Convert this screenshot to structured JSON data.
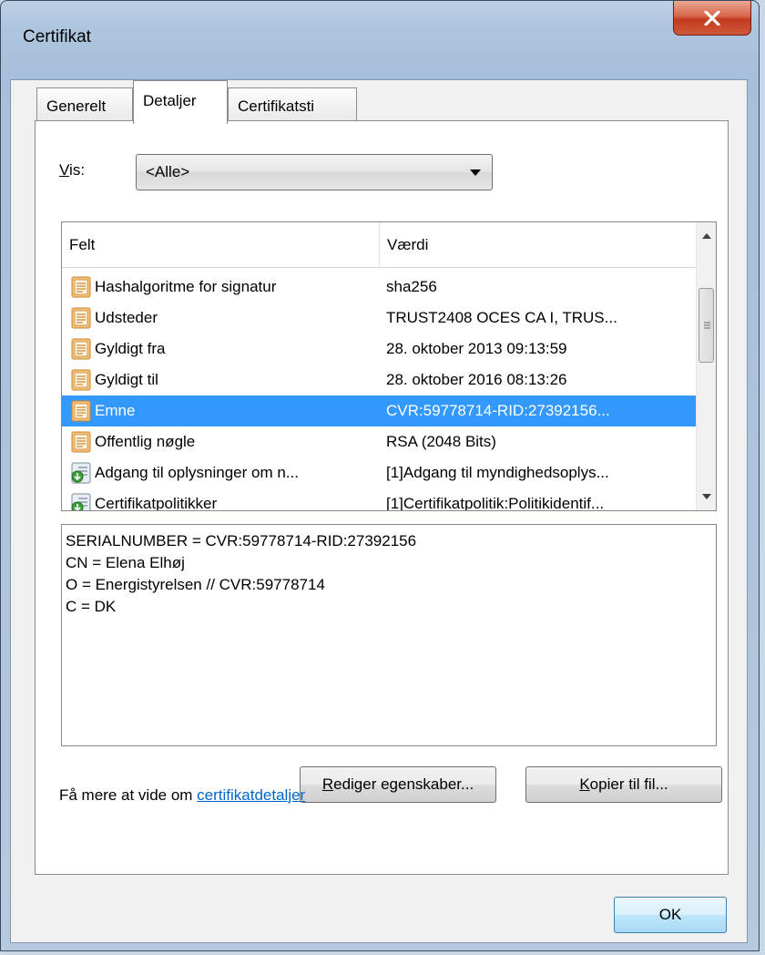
{
  "window": {
    "title": "Certifikat"
  },
  "tabs": [
    {
      "label": "Generelt",
      "active": false
    },
    {
      "label": "Detaljer",
      "active": true
    },
    {
      "label": "Certifikatsti",
      "active": false
    }
  ],
  "filter": {
    "label_accel": "V",
    "label_rest": "is:",
    "selected": "<Alle>"
  },
  "list": {
    "columns": [
      "Felt",
      "Værdi"
    ],
    "rows": [
      {
        "field": "Hashalgoritme for signatur",
        "value": "sha256",
        "icon": "certificate-field-icon"
      },
      {
        "field": "Udsteder",
        "value": "TRUST2408 OCES CA I, TRUS...",
        "icon": "certificate-field-icon"
      },
      {
        "field": "Gyldigt fra",
        "value": "28. oktober 2013 09:13:59",
        "icon": "certificate-field-icon"
      },
      {
        "field": "Gyldigt til",
        "value": "28. oktober 2016 08:13:26",
        "icon": "certificate-field-icon"
      },
      {
        "field": "Emne",
        "value": "CVR:59778714-RID:27392156...",
        "icon": "certificate-field-icon",
        "selected": true
      },
      {
        "field": "Offentlig nøgle",
        "value": "RSA (2048 Bits)",
        "icon": "certificate-field-icon"
      },
      {
        "field": "Adgang til oplysninger om n...",
        "value": "[1]Adgang til myndighedsoplys...",
        "icon": "certificate-extension-icon"
      },
      {
        "field": "Certifikatpolitikker",
        "value": "[1]Certifikatpolitik:Politikidentif...",
        "icon": "certificate-extension-icon"
      }
    ]
  },
  "details": {
    "text": "SERIALNUMBER = CVR:59778714-RID:27392156\nCN = Elena Elhøj\nO = Energistyrelsen // CVR:59778714\nC = DK"
  },
  "buttons": {
    "edit_accel": "R",
    "edit_rest": "ediger egenskaber...",
    "copy_accel": "K",
    "copy_rest": "opier til fil...",
    "ok": "OK"
  },
  "footer": {
    "text": "Få mere at vide om ",
    "link": "certifikatdetaljer"
  },
  "colors": {
    "selection": "#3399ff",
    "link": "#0066cc",
    "close_button": "#c23a1e"
  }
}
